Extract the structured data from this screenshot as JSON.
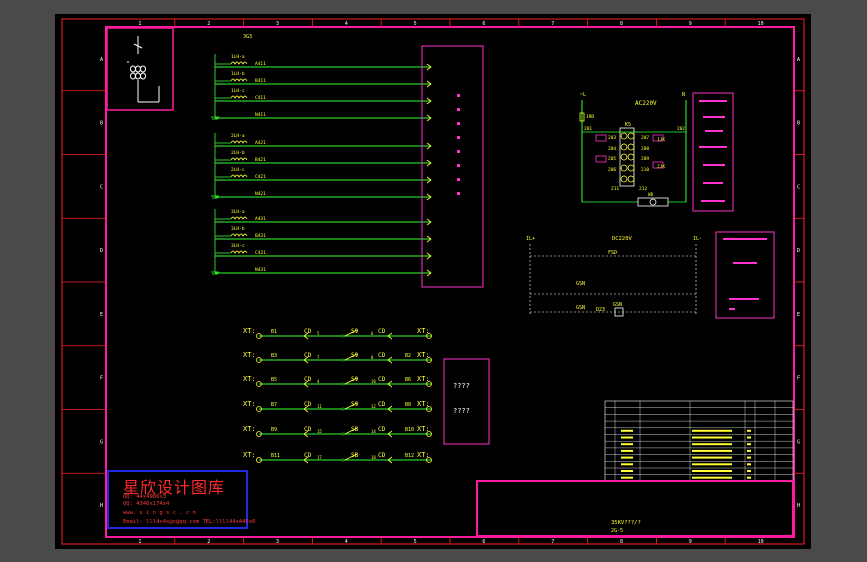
{
  "frame": {
    "top_numbers": [
      "1",
      "2",
      "3",
      "4",
      "5",
      "6",
      "7",
      "8",
      "9",
      "10"
    ],
    "side_letters": [
      "A",
      "B",
      "C",
      "D",
      "E",
      "F",
      "G",
      "H"
    ]
  },
  "ct_section": {
    "header": "3G3",
    "groups": [
      {
        "wires": [
          {
            "coil": "1LH-a",
            "label": "A411"
          },
          {
            "coil": "1LH-b",
            "label": "B411"
          },
          {
            "coil": "1LH-c",
            "label": "C411"
          },
          {
            "coil": "",
            "label": "N411"
          }
        ]
      },
      {
        "wires": [
          {
            "coil": "2LH-a",
            "label": "A421"
          },
          {
            "coil": "2LH-b",
            "label": "B421"
          },
          {
            "coil": "2LH-c",
            "label": "C421"
          },
          {
            "coil": "",
            "label": "N421"
          }
        ]
      },
      {
        "wires": [
          {
            "coil": "3LH-a",
            "label": "A431"
          },
          {
            "coil": "3LH-b",
            "label": "B431"
          },
          {
            "coil": "3LH-c",
            "label": "C431"
          },
          {
            "coil": "",
            "label": "N431"
          }
        ]
      }
    ]
  },
  "control_section": {
    "voltage_label": "AC220V",
    "left_terminal": "~L",
    "right_terminal": "N",
    "fuse_label": "1RD",
    "switch_label": "KS",
    "nodes": {
      "n201": "201",
      "n202": "202",
      "n203": "203",
      "n204": "204",
      "n205": "205",
      "n206": "206",
      "n207": "207",
      "n208": "208",
      "n209": "209",
      "n210": "210",
      "n211": "211",
      "n212": "212"
    },
    "coil_1": "1JK",
    "coil_2": "2JK",
    "lamp_1": "WD"
  },
  "dc_section": {
    "voltage_label": "DC220V",
    "left_terminal": "IL+",
    "right_terminal": "IL-",
    "fuse_label": "FSD",
    "contact_1": "GSN",
    "contact_2": "GSN",
    "node_label": "D23",
    "coil_label": "GSN"
  },
  "trip_section": {
    "rows": [
      {
        "xt": "XT:",
        "t1": "B1",
        "cd": "CD",
        "cds": "5",
        "s": "S9",
        "s2": "6",
        "cd2": "CD",
        "t2": "",
        "xt2": "XT:"
      },
      {
        "xt": "XT:",
        "t1": "B3",
        "cd": "CD",
        "cds": "7",
        "s": "S9",
        "s2": "8",
        "cd2": "CD",
        "t2": "B2",
        "xt2": "XT:"
      },
      {
        "xt": "XT:",
        "t1": "B5",
        "cd": "CD",
        "cds": "4",
        "s": "S9",
        "s2": "10",
        "cd2": "CD",
        "t2": "B6",
        "xt2": "XT:"
      },
      {
        "xt": "XT:",
        "t1": "B7",
        "cd": "CD",
        "cds": "11",
        "s": "S9",
        "s2": "12",
        "cd2": "CD",
        "t2": "B8",
        "xt2": "XT:"
      },
      {
        "xt": "XT:",
        "t1": "B9",
        "cd": "CD",
        "cds": "15",
        "s": "SB",
        "s2": "14",
        "cd2": "CD",
        "t2": "B10",
        "xt2": "XT:"
      },
      {
        "xt": "XT:",
        "t1": "B11",
        "cd": "CD",
        "cds": "17",
        "s": "SB",
        "s2": "18",
        "cd2": "CD",
        "t2": "B12",
        "xt2": "XT:"
      }
    ],
    "box_label_1": "????",
    "box_label_2": "????"
  },
  "title_block": {
    "drawing_name": "35KV???/?",
    "drawing_no": "2G-5"
  },
  "watermark": {
    "title": "星欣设计图库",
    "line1": "QQ:  44x4986x3",
    "line2": "QQ:  4346x174x4",
    "line3": "www.  x i n g s c . c n",
    "line4": "Email: lll4x4x@x@qq.com  TEL:llll44x445x0"
  },
  "colors": {
    "frame": "#ff1aa0",
    "wire": "#33ff33",
    "text": "#ffff33",
    "box": "#ff33cc",
    "white": "#ffffff",
    "border_dark": "#ff2020"
  }
}
